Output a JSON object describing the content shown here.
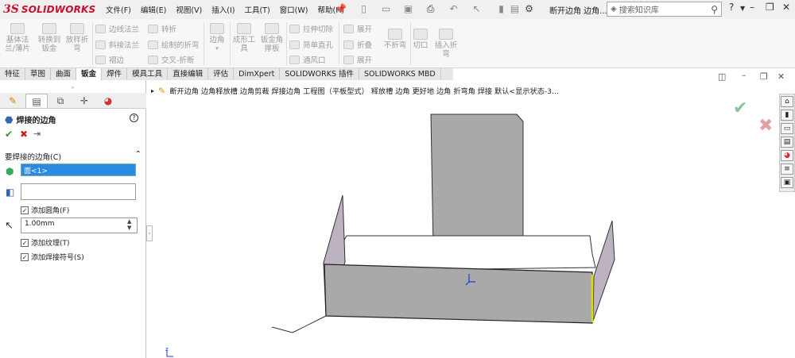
{
  "app": {
    "brand_prefix": "3S",
    "brand": "SOLIDWORKS",
    "doc_title": "断开边角 边角...",
    "search_placeholder": "搜索知识库",
    "help": "?"
  },
  "menu": [
    "文件(F)",
    "编辑(E)",
    "视图(V)",
    "插入(I)",
    "工具(T)",
    "窗口(W)",
    "帮助(H)"
  ],
  "ribbon": {
    "big": [
      "基体法兰/薄片",
      "转换到钣金",
      "放样折弯",
      "边角",
      "成形工具",
      "钣金角撑板",
      "展开",
      "折叠",
      "不折弯",
      "切口",
      "插入折弯"
    ],
    "small": [
      "边线法兰",
      "斜接法兰",
      "褶边",
      "转折",
      "绘制的折弯",
      "交叉-折断",
      "拉伸切除",
      "简单直孔",
      "通风口",
      "展开"
    ]
  },
  "tabs": [
    "特征",
    "草图",
    "曲面",
    "钣金",
    "焊件",
    "模具工具",
    "直接编辑",
    "评估",
    "DimXpert",
    "SOLIDWORKS 插件",
    "SOLIDWORKS MBD"
  ],
  "active_tab": "钣金",
  "panel": {
    "title": "焊接的边角",
    "section": "要焊接的边角(C)",
    "faces": "面<1>",
    "add_fillet": "添加圆角(F)",
    "radius": "1.00mm",
    "add_texture": "添加纹理(T)",
    "add_weld_symbol": "添加焊接符号(S)"
  },
  "breadcrumb": "断开边角  边角释放槽  边角剪裁  焊接边角  工程图（平板型式）  释放槽  边角  更好地  边角  折弯角  焊接  默认<显示状态-3...",
  "colors": {
    "accent": "#2a8be0",
    "ok": "#2a9a2a",
    "cancel": "#cc2222",
    "part_face": "#a9a9a9",
    "flange": "#bcb2c0",
    "highlight": "#d8e000"
  }
}
